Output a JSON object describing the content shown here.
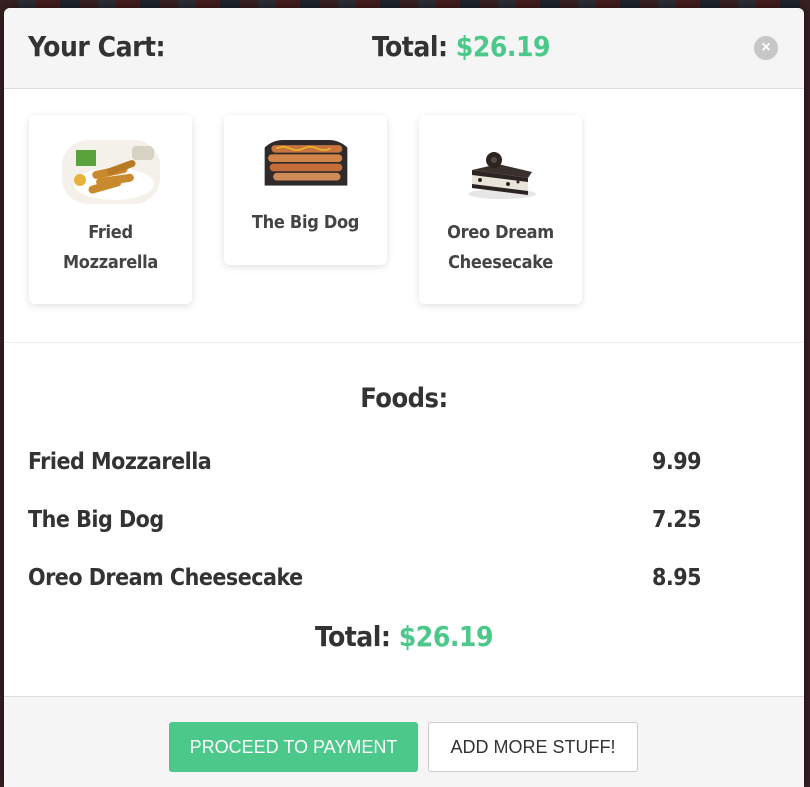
{
  "header": {
    "title": "Your Cart:",
    "total_label": "Total:",
    "total_amount": "$26.19",
    "close_label": "×"
  },
  "cart_items": [
    {
      "name": "Fried Mozzarella",
      "image": "fried-mozzarella-photo"
    },
    {
      "name": "The Big Dog",
      "image": "hot-dog-photo"
    },
    {
      "name": "Oreo Dream Cheesecake",
      "image": "cheesecake-photo"
    }
  ],
  "foods": {
    "title": "Foods:",
    "items": [
      {
        "name": "Fried Mozzarella",
        "price": "9.99"
      },
      {
        "name": "The Big Dog",
        "price": "7.25"
      },
      {
        "name": "Oreo Dream Cheesecake",
        "price": "8.95"
      }
    ],
    "total_label": "Total:",
    "total_amount": "$26.19"
  },
  "footer": {
    "proceed_label": "PROCEED TO PAYMENT",
    "add_more_label": "ADD MORE STUFF!"
  },
  "colors": {
    "accent": "#4cc98a",
    "text": "#333333",
    "header_bg": "#f5f5f5"
  }
}
